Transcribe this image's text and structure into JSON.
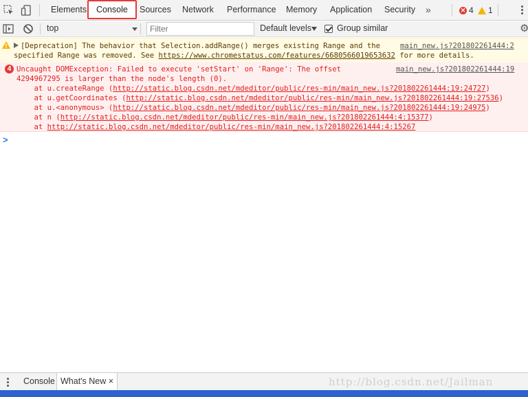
{
  "tabs": {
    "items": [
      {
        "label": "Elements"
      },
      {
        "label": "Console",
        "active": true
      },
      {
        "label": "Sources"
      },
      {
        "label": "Network"
      },
      {
        "label": "Performance"
      },
      {
        "label": "Memory"
      },
      {
        "label": "Application"
      },
      {
        "label": "Security"
      }
    ],
    "more_icon": "double-chevron-right-icon",
    "error_count": "4",
    "warning_count": "1"
  },
  "toolbar": {
    "context": "top",
    "filter_placeholder": "Filter",
    "levels": "Default levels",
    "group_similar": "Group similar",
    "group_similar_checked": true
  },
  "warning": {
    "text_line1": "[Deprecation] The behavior that Selection.addRange() merges existing Range and the ",
    "source": "main_new.js?201802261444:2",
    "text_line2_prefix": "specified Range was removed. See ",
    "link": "https://www.chromestatus.com/features/6680566019653632",
    "text_line2_suffix": " for more details."
  },
  "error": {
    "count": "4",
    "line1": "Uncaught DOMException: Failed to execute 'setStart' on 'Range': The offset",
    "source": "main_new.js?201802261444:19",
    "line2": "4294967295 is larger than the node's length (0).",
    "stack": [
      {
        "prefix": "    at u.createRange (",
        "url": "http://static.blog.csdn.net/mdeditor/public/res-min/main_new.js?201802261444:19:24727",
        "suffix": ")"
      },
      {
        "prefix": "    at u.getCoordinates (",
        "url": "http://static.blog.csdn.net/mdeditor/public/res-min/main_new.js?201802261444:19:27536",
        "suffix": ")"
      },
      {
        "prefix": "    at u.<anonymous> (",
        "url": "http://static.blog.csdn.net/mdeditor/public/res-min/main_new.js?201802261444:19:24975",
        "suffix": ")"
      },
      {
        "prefix": "    at n (",
        "url": "http://static.blog.csdn.net/mdeditor/public/res-min/main_new.js?201802261444:4:15377",
        "suffix": ")"
      },
      {
        "prefix": "    at ",
        "url": "http://static.blog.csdn.net/mdeditor/public/res-min/main_new.js?201802261444:4:15267",
        "suffix": ""
      }
    ]
  },
  "prompt": ">",
  "drawer": {
    "tabs": [
      {
        "label": "Console"
      },
      {
        "label": "What's New",
        "active": true
      }
    ],
    "close": "×"
  },
  "watermark": "http://blog.csdn.net/Jailman"
}
